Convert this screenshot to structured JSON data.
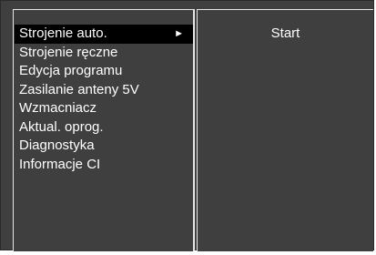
{
  "menu": {
    "items": [
      {
        "label": "Strojenie auto.",
        "selected": true,
        "arrow": "►"
      },
      {
        "label": "Strojenie ręczne"
      },
      {
        "label": "Edycja programu"
      },
      {
        "label": "Zasilanie anteny 5V"
      },
      {
        "label": "Wzmacniacz"
      },
      {
        "label": "Aktual. oprog."
      },
      {
        "label": "Diagnostyka"
      },
      {
        "label": "Informacje CI"
      }
    ]
  },
  "submenu": {
    "start_label": "Start"
  },
  "colors": {
    "panel_bg": "#3f3f3f",
    "selected_bg": "#000000",
    "text": "#ffffff",
    "border": "#e6e6e6"
  }
}
